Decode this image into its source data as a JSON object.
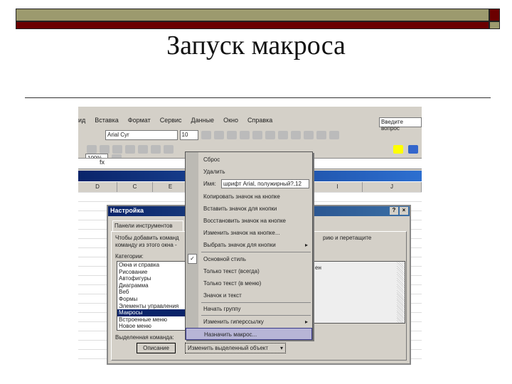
{
  "slide": {
    "title": "Запуск макроса",
    "colors": {
      "olive": "#9c9a6e",
      "dark_red": "#6b0000"
    }
  },
  "excel": {
    "menu": [
      "ид",
      "Вставка",
      "Формат",
      "Сервис",
      "Данные",
      "Окно",
      "Справка"
    ],
    "question_box": "Введите вопрос",
    "font_name": "Arial Cyr",
    "font_size": "10",
    "zoom": "100%",
    "columns": [
      "D",
      "C",
      "E",
      "I",
      "J"
    ]
  },
  "dialog": {
    "title": "Настройка",
    "tab": "Панели инструментов",
    "instruction_1": "Чтобы добавить команд",
    "instruction_1_end": "рию и перетащите",
    "instruction_2": "команду из этого окна -",
    "categories_label": "Категории:",
    "categories": [
      "Окна и справка",
      "Рисование",
      "Автофигуры",
      "Диаграмма",
      "Веб",
      "Формы",
      "Элементы управления",
      "Макросы",
      "Встроенные меню",
      "Новое меню"
    ],
    "selected_category": "Макросы",
    "commands_partial": "ен",
    "selected_command_label": "Выделенная команда:",
    "description_button": "Описание",
    "modify_button": "Изменить выделенный объект"
  },
  "context_menu": {
    "items": [
      {
        "label": "Сброс"
      },
      {
        "label": "Удалить"
      },
      {
        "label": "Имя:",
        "value": "шрифт Arial, полужирный?,12"
      },
      {
        "label": "Копировать значок на кнопке"
      },
      {
        "label": "Вставить значок для кнопки"
      },
      {
        "label": "Восстановить значок на кнопке"
      },
      {
        "label": "Изменить значок на кнопке..."
      },
      {
        "label": "Выбрать значок для кнопки"
      },
      {
        "label": "Основной стиль"
      },
      {
        "label": "Только текст (всегда)"
      },
      {
        "label": "Только текст (в меню)"
      },
      {
        "label": "Значок и текст"
      },
      {
        "label": "Начать группу"
      },
      {
        "label": "Изменить гиперссылку"
      },
      {
        "label": "Назначить макрос..."
      }
    ],
    "checked": "Основной стиль",
    "highlighted": "Назначить макрос..."
  }
}
